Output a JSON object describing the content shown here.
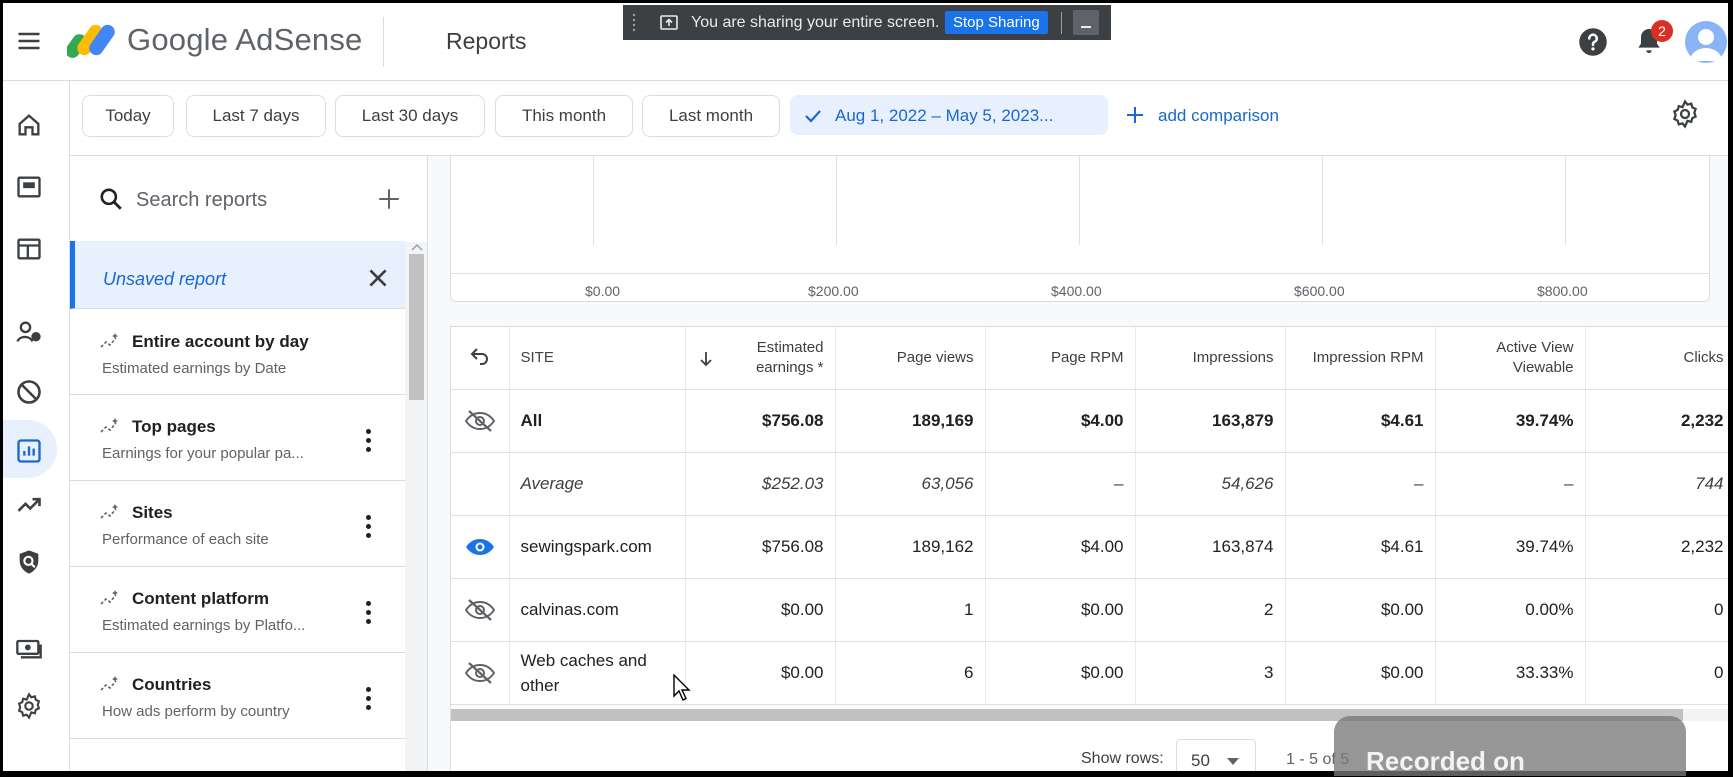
{
  "app": {
    "logo_text": "Google AdSense",
    "page_title": "Reports",
    "notification_count": "2",
    "brand_colors": {
      "blue": "#4285f4",
      "yellow": "#fbbc04",
      "green": "#34a853",
      "accent": "#1a73e8"
    }
  },
  "share_banner": {
    "message": "You are sharing your entire screen.",
    "stop_label": "Stop Sharing"
  },
  "nav_icons": [
    "home-icon",
    "ads-icon",
    "sites-icon",
    "users-icon",
    "blocking-icon",
    "reports-icon",
    "optimization-icon",
    "privacy-icon",
    "payments-icon",
    "settings-icon"
  ],
  "filters": {
    "chips": [
      "Today",
      "Last 7 days",
      "Last 30 days",
      "This month",
      "Last month"
    ],
    "selected_range": "Aug 1, 2022 – May 5, 2023...",
    "add_comparison": "add comparison"
  },
  "reports_panel": {
    "search_placeholder": "Search reports",
    "unsaved_label": "Unsaved report",
    "items": [
      {
        "title": "Entire account by day",
        "subtitle": "Estimated earnings by Date"
      },
      {
        "title": "Top pages",
        "subtitle": "Earnings for your popular pa..."
      },
      {
        "title": "Sites",
        "subtitle": "Performance of each site"
      },
      {
        "title": "Content platform",
        "subtitle": "Estimated earnings by Platfo..."
      },
      {
        "title": "Countries",
        "subtitle": "How ads perform by country"
      }
    ]
  },
  "chart": {
    "x_ticks": [
      "$0.00",
      "$200.00",
      "$400.00",
      "$600.00",
      "$800.00"
    ]
  },
  "table": {
    "headers": {
      "site": "SITE",
      "estimated_earnings": "Estimated earnings *",
      "page_views": "Page views",
      "page_rpm": "Page RPM",
      "impressions": "Impressions",
      "impression_rpm": "Impression RPM",
      "active_view": "Active View Viewable",
      "clicks": "Clicks"
    },
    "rows": [
      {
        "site": "All",
        "earnings": "$756.08",
        "page_views": "189,169",
        "page_rpm": "$4.00",
        "impressions": "163,879",
        "impression_rpm": "$4.61",
        "active_view": "39.74%",
        "clicks": "2,232"
      },
      {
        "site": "Average",
        "earnings": "$252.03",
        "page_views": "63,056",
        "page_rpm": "–",
        "impressions": "54,626",
        "impression_rpm": "–",
        "active_view": "–",
        "clicks": "744"
      },
      {
        "site": "sewingspark.com",
        "earnings": "$756.08",
        "page_views": "189,162",
        "page_rpm": "$4.00",
        "impressions": "163,874",
        "impression_rpm": "$4.61",
        "active_view": "39.74%",
        "clicks": "2,232"
      },
      {
        "site": "calvinas.com",
        "earnings": "$0.00",
        "page_views": "1",
        "page_rpm": "$0.00",
        "impressions": "2",
        "impression_rpm": "$0.00",
        "active_view": "0.00%",
        "clicks": "0"
      },
      {
        "site": "Web caches and other",
        "earnings": "$0.00",
        "page_views": "6",
        "page_rpm": "$0.00",
        "impressions": "3",
        "impression_rpm": "$0.00",
        "active_view": "33.33%",
        "clicks": "0"
      }
    ]
  },
  "footer": {
    "show_rows_label": "Show rows:",
    "rows_value": "50",
    "pagination": "1 - 5 of 5"
  },
  "overlay": {
    "watermark": "Recorded on"
  }
}
